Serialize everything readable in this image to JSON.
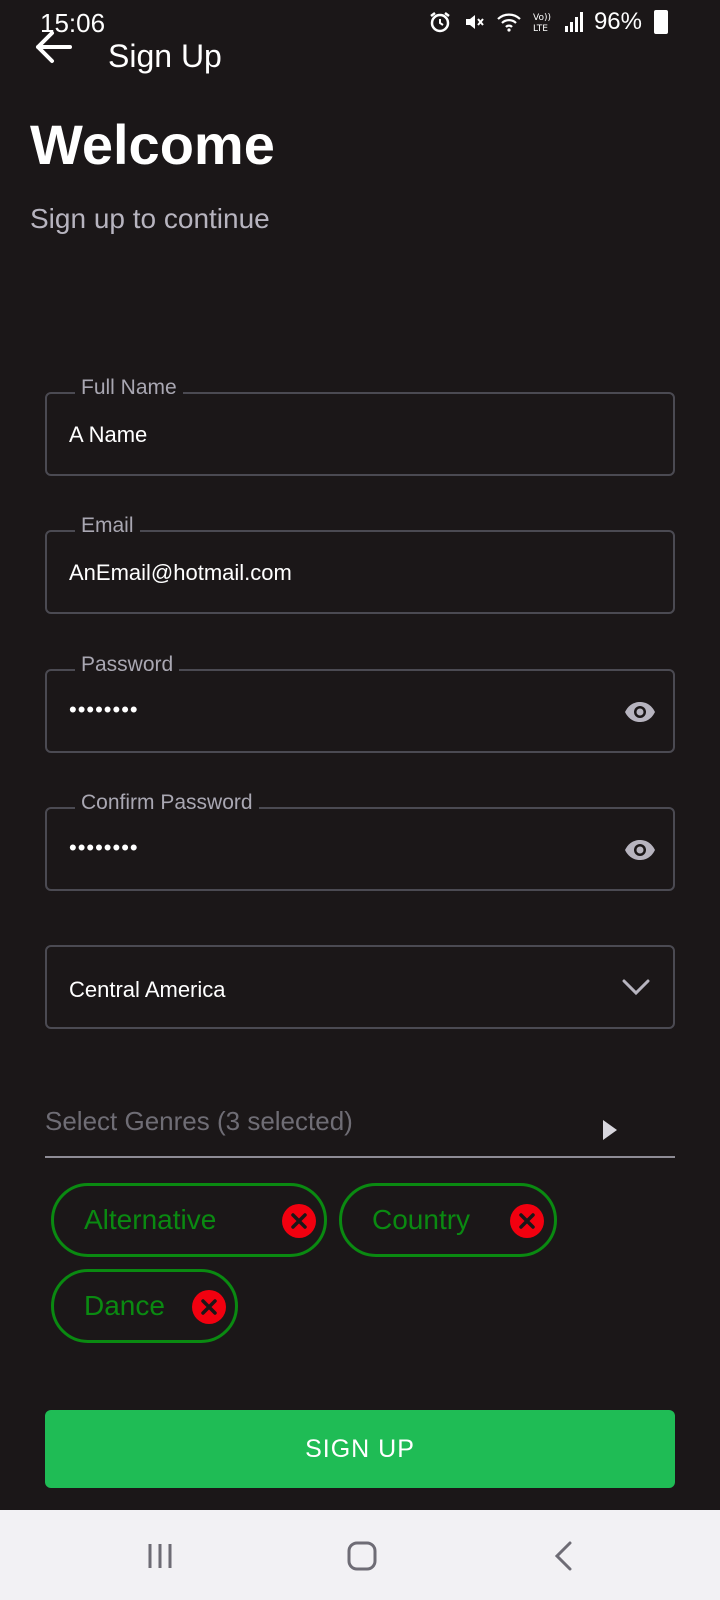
{
  "status_bar": {
    "time": "15:06",
    "battery": "96%",
    "icons": [
      "alarm-icon",
      "mute-icon",
      "wifi-icon",
      "volte-icon",
      "signal-icon",
      "battery-icon"
    ]
  },
  "app_bar": {
    "title": "Sign Up",
    "back_icon": "arrow-left-icon"
  },
  "header": {
    "welcome": "Welcome",
    "subtitle": "Sign up to continue"
  },
  "form": {
    "full_name": {
      "label": "Full Name",
      "value": "A Name"
    },
    "email": {
      "label": "Email",
      "value": "AnEmail@hotmail.com"
    },
    "password": {
      "label": "Password",
      "value": "••••••••"
    },
    "confirm_password": {
      "label": "Confirm Password",
      "value": "••••••••"
    },
    "region": {
      "value": "Central America"
    },
    "genres": {
      "placeholder": "Select Genres (3 selected)",
      "chips": [
        {
          "label": "Alternative"
        },
        {
          "label": "Country"
        },
        {
          "label": "Dance"
        }
      ]
    },
    "submit_label": "SIGN UP"
  },
  "colors": {
    "background": "#1b1718",
    "accent_green": "#1fbc55",
    "chip_green": "#0a8a11",
    "remove_red": "#f2000f",
    "nav_bar": "#f2f1f4"
  }
}
